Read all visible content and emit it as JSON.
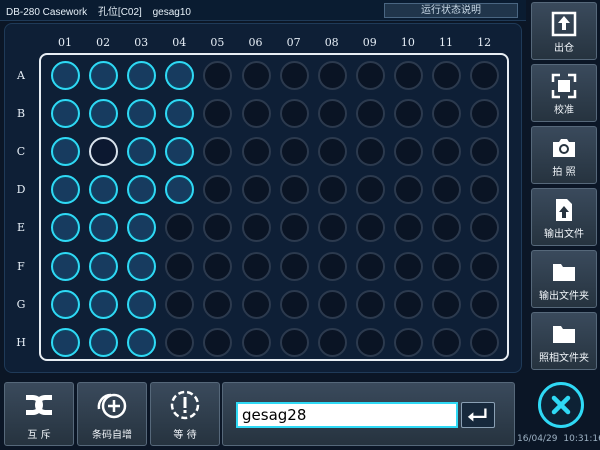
{
  "header": {
    "instrument": "DB-280 Casework",
    "position_label": "孔位[C02]",
    "sample_id": "gesag10",
    "status_button": "运行状态说明"
  },
  "plate": {
    "columns": [
      "01",
      "02",
      "03",
      "04",
      "05",
      "06",
      "07",
      "08",
      "09",
      "10",
      "11",
      "12"
    ],
    "rows": [
      "A",
      "B",
      "C",
      "D",
      "E",
      "F",
      "G",
      "H"
    ],
    "filled_per_column": [
      8,
      8,
      8,
      4,
      0,
      0,
      0,
      0,
      0,
      0,
      0,
      0
    ],
    "current_well": "C02",
    "colors": {
      "filled": "#2fd9f5",
      "empty": "#2c3a4e",
      "current": "#d8e2ec"
    }
  },
  "sidebar": {
    "items": [
      {
        "label": "出仓",
        "icon": "eject-icon"
      },
      {
        "label": "校准",
        "icon": "calibrate-icon"
      },
      {
        "label": "拍 照",
        "icon": "camera-icon"
      },
      {
        "label": "输出文件",
        "icon": "export-file-icon"
      },
      {
        "label": "输出文件夹",
        "icon": "export-folder-icon"
      },
      {
        "label": "照相文件夹",
        "icon": "photo-folder-icon"
      }
    ]
  },
  "bottom": {
    "mutex_label": "互 斥",
    "barcode_increment_label": "条码自增",
    "wait_label": "等 待",
    "barcode_value": "gesag28",
    "enter_icon": "enter-icon",
    "close_icon": "close-icon"
  },
  "footer": {
    "date": "16/04/29",
    "time": "10:31:16"
  }
}
